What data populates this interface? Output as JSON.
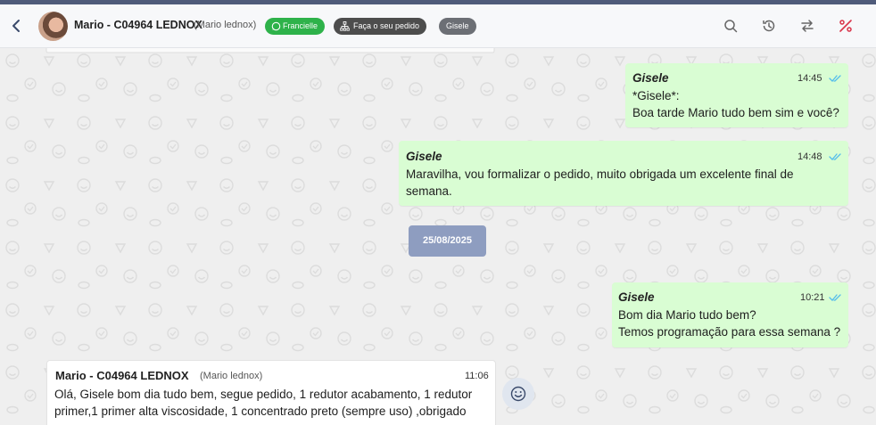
{
  "header": {
    "contact_name": "Mario - C04964 LEDNOX",
    "contact_sub": "(Mario lednox)",
    "tags": [
      {
        "label": "Francielle",
        "color": "#2eb24a",
        "icon": "whatsapp-icon"
      },
      {
        "label": "Faça o seu pedido",
        "color": "#4d4d4d",
        "icon": "sitemap-icon"
      },
      {
        "label": "Gisele",
        "color": "#6c6f75"
      }
    ],
    "icons": [
      "search-icon",
      "history-icon",
      "transfer-icon",
      "percent-icon"
    ]
  },
  "messages": [
    {
      "sender": "Gisele",
      "time": "14:45",
      "text": "*Gisele*:\nBoa tarde Mario tudo bem sim e você?"
    },
    {
      "sender": "Gisele",
      "time": "14:48",
      "text": "Maravilha, vou formalizar o pedido, muito obrigada um excelente final de\nsemana."
    },
    {
      "sender": "Gisele",
      "time": "10:21",
      "text": "Bom dia Mario tudo bem?\nTemos programação para essa semana ?"
    }
  ],
  "date_separator": "25/08/2025",
  "incoming": {
    "name": "Mario - C04964 LEDNOX",
    "sub": "(Mario lednox)",
    "time": "11:06",
    "text": "Olá, Gisele bom dia tudo bem, segue pedido, 1 redutor acabamento, 1 redutor\nprimer,1 primer alta viscosidade, 1 concentrado preto (sempre uso) ,obrigado"
  },
  "colors": {
    "outgoing_bubble": "#d9fdd3",
    "date_chip": "#8e9dc0",
    "read_check": "#53bdeb",
    "accent_red": "#d9344a"
  }
}
